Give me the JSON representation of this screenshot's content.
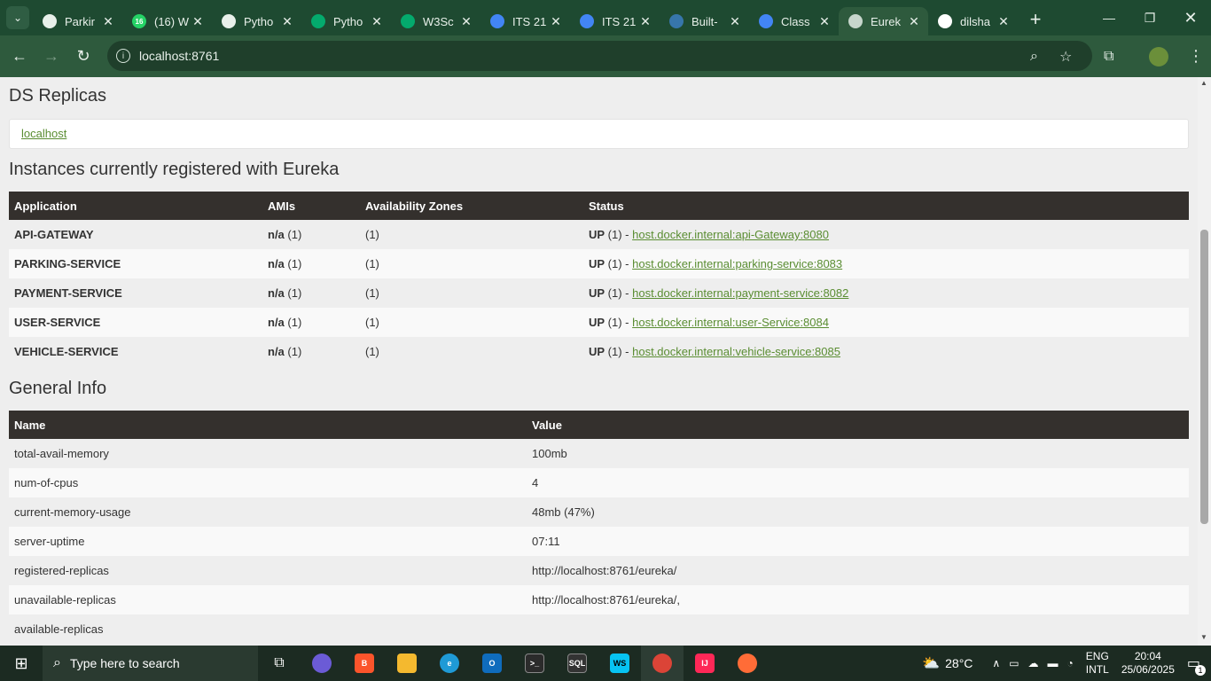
{
  "browser": {
    "tabs": [
      {
        "title": "Parkir",
        "favicon": "openai-icon",
        "color": "#e8f0ea"
      },
      {
        "title": "(16) W",
        "favicon": "whatsapp-icon",
        "color": "#25d366",
        "badge": "16"
      },
      {
        "title": "Pytho",
        "favicon": "openai-icon",
        "color": "#e8f0ea"
      },
      {
        "title": "Pytho",
        "favicon": "w3schools-icon",
        "color": "#04aa6d"
      },
      {
        "title": "W3Sc",
        "favicon": "w3schools-icon",
        "color": "#04aa6d"
      },
      {
        "title": "ITS 21",
        "favicon": "classroom-icon",
        "color": "#4285f4"
      },
      {
        "title": "ITS 21",
        "favicon": "classroom-icon",
        "color": "#4285f4"
      },
      {
        "title": "Built-",
        "favicon": "python-icon",
        "color": "#3776ab"
      },
      {
        "title": "Class",
        "favicon": "classroom-icon",
        "color": "#4285f4"
      },
      {
        "title": "Eurek",
        "favicon": "globe-icon",
        "color": "#c7d6cc",
        "active": true
      },
      {
        "title": "dilsha",
        "favicon": "github-icon",
        "color": "#ffffff"
      }
    ],
    "address": "localhost:8761"
  },
  "page": {
    "ds_replicas_title": "DS Replicas",
    "ds_replica_link": "localhost",
    "instances_title": "Instances currently registered with Eureka",
    "instances_headers": [
      "Application",
      "AMIs",
      "Availability Zones",
      "Status"
    ],
    "instances": [
      {
        "app": "API-GATEWAY",
        "ami": "n/a",
        "ami_count": " (1)",
        "zones": "(1)",
        "status": "UP",
        "status_count": " (1) - ",
        "link": "host.docker.internal:api-Gateway:8080"
      },
      {
        "app": "PARKING-SERVICE",
        "ami": "n/a",
        "ami_count": " (1)",
        "zones": "(1)",
        "status": "UP",
        "status_count": " (1) - ",
        "link": "host.docker.internal:parking-service:8083"
      },
      {
        "app": "PAYMENT-SERVICE",
        "ami": "n/a",
        "ami_count": " (1)",
        "zones": "(1)",
        "status": "UP",
        "status_count": " (1) - ",
        "link": "host.docker.internal:payment-service:8082"
      },
      {
        "app": "USER-SERVICE",
        "ami": "n/a",
        "ami_count": " (1)",
        "zones": "(1)",
        "status": "UP",
        "status_count": " (1) - ",
        "link": "host.docker.internal:user-Service:8084"
      },
      {
        "app": "VEHICLE-SERVICE",
        "ami": "n/a",
        "ami_count": " (1)",
        "zones": "(1)",
        "status": "UP",
        "status_count": " (1) - ",
        "link": "host.docker.internal:vehicle-service:8085"
      }
    ],
    "general_title": "General Info",
    "general_headers": [
      "Name",
      "Value"
    ],
    "general": [
      {
        "name": "total-avail-memory",
        "value": "100mb"
      },
      {
        "name": "num-of-cpus",
        "value": "4"
      },
      {
        "name": "current-memory-usage",
        "value": "48mb (47%)"
      },
      {
        "name": "server-uptime",
        "value": "07:11"
      },
      {
        "name": "registered-replicas",
        "value": "http://localhost:8761/eureka/"
      },
      {
        "name": "unavailable-replicas",
        "value": "http://localhost:8761/eureka/,"
      },
      {
        "name": "available-replicas",
        "value": ""
      }
    ]
  },
  "taskbar": {
    "search_placeholder": "Type here to search",
    "weather": "28°C",
    "lang_top": "ENG",
    "lang_bottom": "INTL",
    "time": "20:04",
    "date": "25/06/2025",
    "notification_count": "1"
  },
  "colors": {
    "tabbar": "#1e4a31",
    "toolbar": "#2e5a3d",
    "table_header": "#34302d",
    "link": "#5a8d32"
  }
}
